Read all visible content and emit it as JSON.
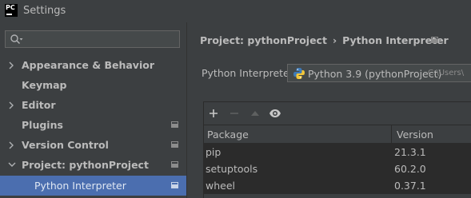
{
  "window": {
    "app_logo_text": "PC",
    "title": "Settings"
  },
  "sidebar": {
    "search": {
      "value": "",
      "placeholder": ""
    },
    "items": [
      {
        "label": "Appearance & Behavior",
        "expandable": true,
        "expanded": false,
        "badge": false
      },
      {
        "label": "Keymap",
        "expandable": false,
        "badge": false
      },
      {
        "label": "Editor",
        "expandable": true,
        "expanded": false,
        "badge": false
      },
      {
        "label": "Plugins",
        "expandable": false,
        "badge": true
      },
      {
        "label": "Version Control",
        "expandable": true,
        "expanded": false,
        "badge": true
      },
      {
        "label": "Project: pythonProject",
        "expandable": true,
        "expanded": true,
        "badge": true
      },
      {
        "label": "Python Interpreter",
        "child": true,
        "selected": true,
        "badge": true
      }
    ]
  },
  "main": {
    "breadcrumb": {
      "parent": "Project: pythonProject",
      "separator": "›",
      "current": "Python Interpreter"
    },
    "interpreter": {
      "label": "Python Interpreter:",
      "value": "Python 3.9 (pythonProject)",
      "path": "C:\\Users\\"
    },
    "packages": {
      "toolbar": [
        "add-icon",
        "remove-icon",
        "upgrade-icon",
        "eye-icon"
      ],
      "columns": [
        "Package",
        "Version"
      ],
      "rows": [
        {
          "package": "pip",
          "version": "21.3.1"
        },
        {
          "package": "setuptools",
          "version": "60.2.0"
        },
        {
          "package": "wheel",
          "version": "0.37.1"
        }
      ]
    }
  },
  "colors": {
    "background": "#3c3f41",
    "selection": "#4b6eaf",
    "table_row": "#2b2b2b",
    "text": "#bbbbbb"
  }
}
